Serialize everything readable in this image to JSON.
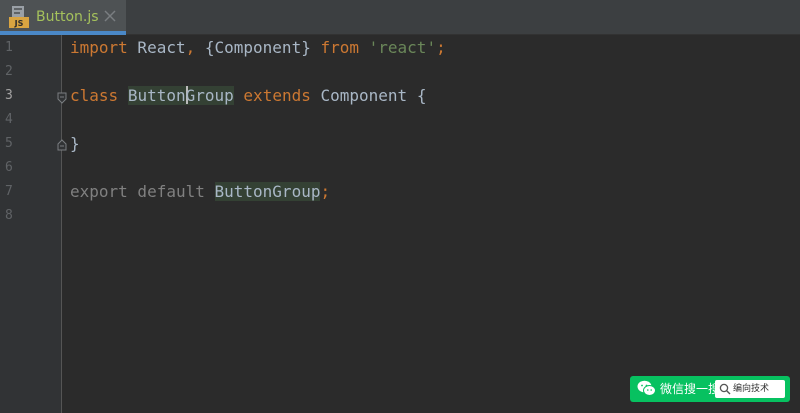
{
  "tab": {
    "filename": "Button.js",
    "icon_badge": "JS",
    "icon": "javascript-file-icon",
    "close_icon": "close-icon"
  },
  "editor": {
    "current_line": 3,
    "line_numbers": [
      "1",
      "2",
      "3",
      "4",
      "5",
      "6",
      "7",
      "8"
    ],
    "code": {
      "line1": {
        "kw_import": "import",
        "react": " React",
        "comma": ",",
        "component_import": " {Component} ",
        "kw_from": "from",
        "space": " ",
        "module": "'react'",
        "semi": ";"
      },
      "line3": {
        "kw_class": "class",
        "space": " ",
        "class_name_start": "Button",
        "class_name_end": "Group",
        "space2": " ",
        "kw_extends": "extends",
        "rest": " Component {"
      },
      "line5": {
        "brace": "}"
      },
      "line7": {
        "export_default": "export default ",
        "identifier": "ButtonGroup",
        "semi": ";"
      }
    }
  },
  "watermark": {
    "label": "微信搜一搜",
    "search_text": "编向技术",
    "icon": "wechat-icon",
    "search_icon": "search-icon"
  },
  "colors": {
    "background": "#2b2b2b",
    "gutter": "#313335",
    "keyword": "#cc7832",
    "string": "#6a8759",
    "text": "#a9b7c6",
    "unused": "#808080",
    "usage_highlight": "#344134",
    "tab_accent": "#4a88c7",
    "tab_label": "#a5c25c",
    "watermark_green": "#07c160"
  }
}
